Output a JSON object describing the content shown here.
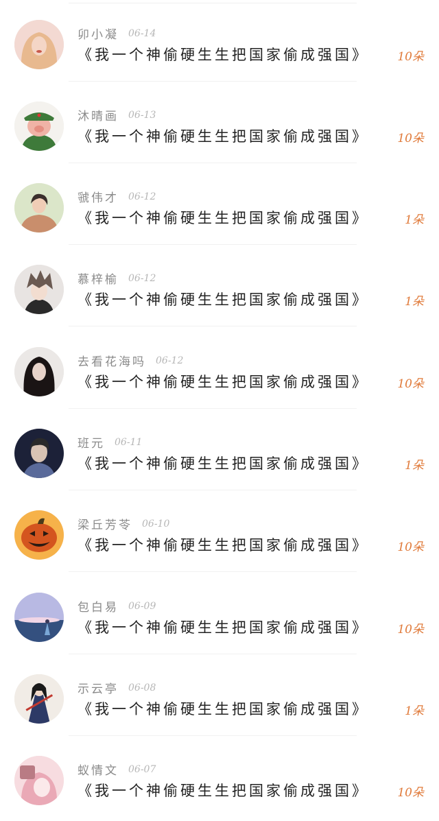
{
  "entries": [
    {
      "username": "卯小凝",
      "date": "06-14",
      "title": "《我一个神偷硬生生把国家偷成强国》",
      "amount": "10朵",
      "avatar_icon": "avatar-blonde-woman-icon",
      "colors": {
        "bg": "#f3d9d2",
        "fg": "#e8b98f",
        "accent": "#c9584a"
      }
    },
    {
      "username": "沐晴画",
      "date": "06-13",
      "title": "《我一个神偷硬生生把国家偷成强国》",
      "amount": "10朵",
      "avatar_icon": "avatar-pig-soldier-icon",
      "colors": {
        "bg": "#f4f2ee",
        "fg": "#3e7a3a",
        "accent": "#f0b3a6"
      }
    },
    {
      "username": "虢伟才",
      "date": "06-12",
      "title": "《我一个神偷硬生生把国家偷成强国》",
      "amount": "1朵",
      "avatar_icon": "avatar-woman-fur-coat-icon",
      "colors": {
        "bg": "#dbe6c9",
        "fg": "#c98e6c",
        "accent": "#3a2f2c"
      }
    },
    {
      "username": "慕梓榆",
      "date": "06-12",
      "title": "《我一个神偷硬生生把国家偷成强国》",
      "amount": "1朵",
      "avatar_icon": "avatar-anime-boy-icon",
      "colors": {
        "bg": "#e8e4e2",
        "fg": "#6b5a52",
        "accent": "#2a2a2a"
      }
    },
    {
      "username": "去看花海吗",
      "date": "06-12",
      "title": "《我一个神偷硬生生把国家偷成强国》",
      "amount": "10朵",
      "avatar_icon": "avatar-dark-hair-girl-icon",
      "colors": {
        "bg": "#ebe8e6",
        "fg": "#1a1414",
        "accent": "#e7d3c9"
      }
    },
    {
      "username": "班元",
      "date": "06-11",
      "title": "《我一个神偷硬生生把国家偷成强国》",
      "amount": "1朵",
      "avatar_icon": "avatar-singer-icon",
      "colors": {
        "bg": "#1c2138",
        "fg": "#d8c3b4",
        "accent": "#5a6a9a"
      }
    },
    {
      "username": "梁丘芳苓",
      "date": "06-10",
      "title": "《我一个神偷硬生生把国家偷成强国》",
      "amount": "10朵",
      "avatar_icon": "avatar-pumpkin-icon",
      "colors": {
        "bg": "#f6b24a",
        "fg": "#d4551f",
        "accent": "#2a1a12"
      }
    },
    {
      "username": "包白易",
      "date": "06-09",
      "title": "《我一个神偷硬生生把国家偷成强国》",
      "amount": "10朵",
      "avatar_icon": "avatar-sea-sunset-icon",
      "colors": {
        "bg": "#b8b9e3",
        "fg": "#f1d6e6",
        "accent": "#34507f"
      }
    },
    {
      "username": "示云亭",
      "date": "06-08",
      "title": "《我一个神偷硬生生把国家偷成强国》",
      "amount": "1朵",
      "avatar_icon": "avatar-ink-warrior-icon",
      "colors": {
        "bg": "#f1ece6",
        "fg": "#2d3a66",
        "accent": "#c23a30"
      }
    },
    {
      "username": "蚁情文",
      "date": "06-07",
      "title": "《我一个神偷硬生生把国家偷成强国》",
      "amount": "10朵",
      "avatar_icon": "avatar-pink-anime-icon",
      "colors": {
        "bg": "#f7dce0",
        "fg": "#eaa9b6",
        "accent": "#b97b84"
      }
    }
  ]
}
